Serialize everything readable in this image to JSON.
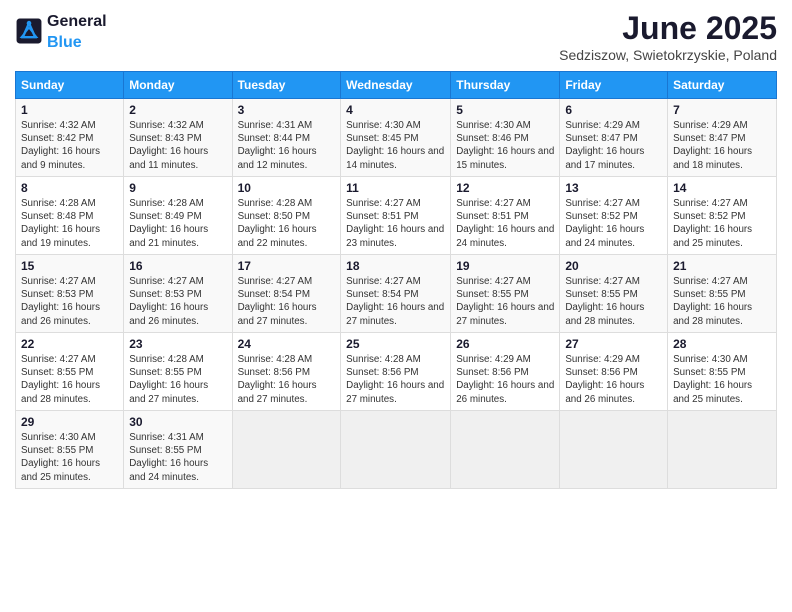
{
  "logo": {
    "general": "General",
    "blue": "Blue"
  },
  "calendar": {
    "title": "June 2025",
    "subtitle": "Sedziszow, Swietokrzyskie, Poland"
  },
  "headers": [
    "Sunday",
    "Monday",
    "Tuesday",
    "Wednesday",
    "Thursday",
    "Friday",
    "Saturday"
  ],
  "weeks": [
    [
      {
        "num": "1",
        "sunrise": "4:32 AM",
        "sunset": "8:42 PM",
        "daylight": "16 hours and 9 minutes."
      },
      {
        "num": "2",
        "sunrise": "4:32 AM",
        "sunset": "8:43 PM",
        "daylight": "16 hours and 11 minutes."
      },
      {
        "num": "3",
        "sunrise": "4:31 AM",
        "sunset": "8:44 PM",
        "daylight": "16 hours and 12 minutes."
      },
      {
        "num": "4",
        "sunrise": "4:30 AM",
        "sunset": "8:45 PM",
        "daylight": "16 hours and 14 minutes."
      },
      {
        "num": "5",
        "sunrise": "4:30 AM",
        "sunset": "8:46 PM",
        "daylight": "16 hours and 15 minutes."
      },
      {
        "num": "6",
        "sunrise": "4:29 AM",
        "sunset": "8:47 PM",
        "daylight": "16 hours and 17 minutes."
      },
      {
        "num": "7",
        "sunrise": "4:29 AM",
        "sunset": "8:47 PM",
        "daylight": "16 hours and 18 minutes."
      }
    ],
    [
      {
        "num": "8",
        "sunrise": "4:28 AM",
        "sunset": "8:48 PM",
        "daylight": "16 hours and 19 minutes."
      },
      {
        "num": "9",
        "sunrise": "4:28 AM",
        "sunset": "8:49 PM",
        "daylight": "16 hours and 21 minutes."
      },
      {
        "num": "10",
        "sunrise": "4:28 AM",
        "sunset": "8:50 PM",
        "daylight": "16 hours and 22 minutes."
      },
      {
        "num": "11",
        "sunrise": "4:27 AM",
        "sunset": "8:51 PM",
        "daylight": "16 hours and 23 minutes."
      },
      {
        "num": "12",
        "sunrise": "4:27 AM",
        "sunset": "8:51 PM",
        "daylight": "16 hours and 24 minutes."
      },
      {
        "num": "13",
        "sunrise": "4:27 AM",
        "sunset": "8:52 PM",
        "daylight": "16 hours and 24 minutes."
      },
      {
        "num": "14",
        "sunrise": "4:27 AM",
        "sunset": "8:52 PM",
        "daylight": "16 hours and 25 minutes."
      }
    ],
    [
      {
        "num": "15",
        "sunrise": "4:27 AM",
        "sunset": "8:53 PM",
        "daylight": "16 hours and 26 minutes."
      },
      {
        "num": "16",
        "sunrise": "4:27 AM",
        "sunset": "8:53 PM",
        "daylight": "16 hours and 26 minutes."
      },
      {
        "num": "17",
        "sunrise": "4:27 AM",
        "sunset": "8:54 PM",
        "daylight": "16 hours and 27 minutes."
      },
      {
        "num": "18",
        "sunrise": "4:27 AM",
        "sunset": "8:54 PM",
        "daylight": "16 hours and 27 minutes."
      },
      {
        "num": "19",
        "sunrise": "4:27 AM",
        "sunset": "8:55 PM",
        "daylight": "16 hours and 27 minutes."
      },
      {
        "num": "20",
        "sunrise": "4:27 AM",
        "sunset": "8:55 PM",
        "daylight": "16 hours and 28 minutes."
      },
      {
        "num": "21",
        "sunrise": "4:27 AM",
        "sunset": "8:55 PM",
        "daylight": "16 hours and 28 minutes."
      }
    ],
    [
      {
        "num": "22",
        "sunrise": "4:27 AM",
        "sunset": "8:55 PM",
        "daylight": "16 hours and 28 minutes."
      },
      {
        "num": "23",
        "sunrise": "4:28 AM",
        "sunset": "8:55 PM",
        "daylight": "16 hours and 27 minutes."
      },
      {
        "num": "24",
        "sunrise": "4:28 AM",
        "sunset": "8:56 PM",
        "daylight": "16 hours and 27 minutes."
      },
      {
        "num": "25",
        "sunrise": "4:28 AM",
        "sunset": "8:56 PM",
        "daylight": "16 hours and 27 minutes."
      },
      {
        "num": "26",
        "sunrise": "4:29 AM",
        "sunset": "8:56 PM",
        "daylight": "16 hours and 26 minutes."
      },
      {
        "num": "27",
        "sunrise": "4:29 AM",
        "sunset": "8:56 PM",
        "daylight": "16 hours and 26 minutes."
      },
      {
        "num": "28",
        "sunrise": "4:30 AM",
        "sunset": "8:55 PM",
        "daylight": "16 hours and 25 minutes."
      }
    ],
    [
      {
        "num": "29",
        "sunrise": "4:30 AM",
        "sunset": "8:55 PM",
        "daylight": "16 hours and 25 minutes."
      },
      {
        "num": "30",
        "sunrise": "4:31 AM",
        "sunset": "8:55 PM",
        "daylight": "16 hours and 24 minutes."
      },
      null,
      null,
      null,
      null,
      null
    ]
  ]
}
